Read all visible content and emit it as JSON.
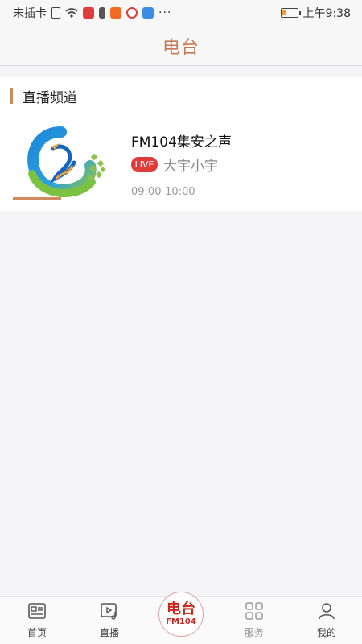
{
  "status_bar": {
    "carrier": "未插卡",
    "more": "···",
    "time": "上午9:38",
    "battery_level": 0.25
  },
  "header": {
    "title": "电台"
  },
  "section": {
    "title": "直播频道"
  },
  "channel": {
    "name": "FM104集安之声",
    "live_badge": "LIVE",
    "host": "大宇小宇",
    "time": "09:00-10:00"
  },
  "bottom_nav": {
    "items": [
      {
        "label": "首页",
        "icon": "news-icon"
      },
      {
        "label": "直播",
        "icon": "video-music-icon"
      },
      {
        "label": "服务",
        "icon": "grid-icon"
      },
      {
        "label": "我的",
        "icon": "user-icon"
      }
    ],
    "center": {
      "big": "电台",
      "small": "FM104"
    }
  },
  "colors": {
    "accent": "#c47a52",
    "live": "#e03b3b",
    "center_red": "#c8281e"
  }
}
